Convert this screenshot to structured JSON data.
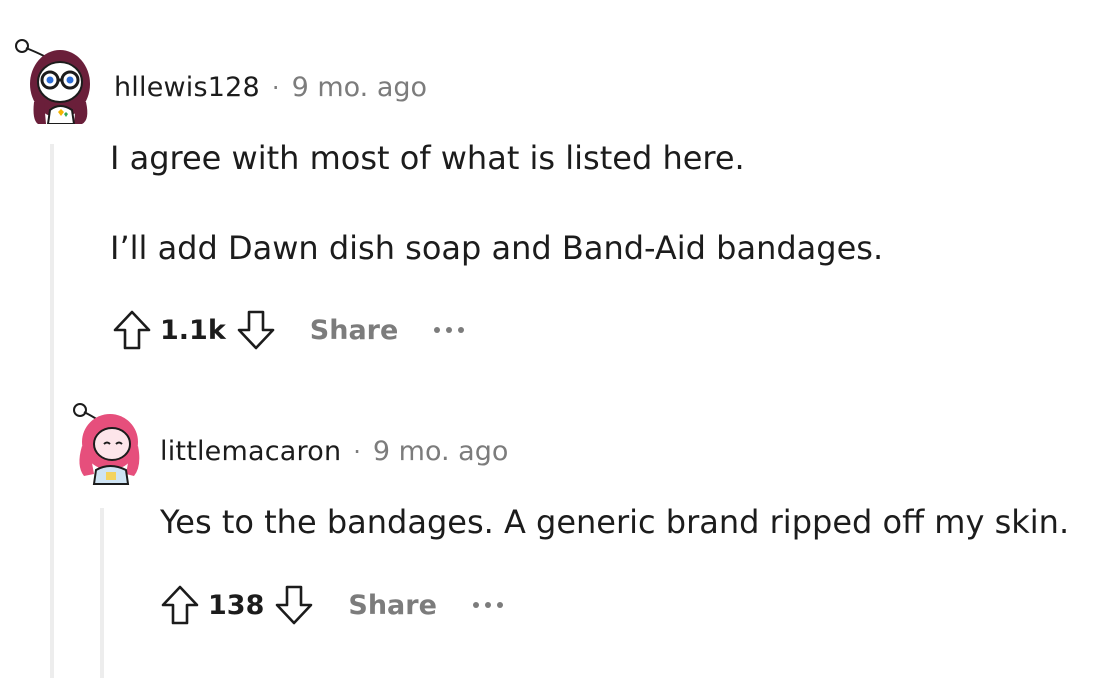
{
  "comments": [
    {
      "username": "hllewis128",
      "separator": "·",
      "time": "9 mo. ago",
      "paragraphs": [
        "I agree with most of what is listed here.",
        "I’ll add Dawn dish soap and Band-Aid bandages."
      ],
      "score": "1.1k",
      "share_label": "Share",
      "avatar_icon": "snoo-avatar-glasses-icon"
    },
    {
      "username": "littlemacaron",
      "separator": "·",
      "time": "9 mo. ago",
      "paragraphs": [
        "Yes to the bandages. A generic brand ripped off my skin."
      ],
      "score": "138",
      "share_label": "Share",
      "avatar_icon": "snoo-avatar-pink-hair-icon"
    }
  ],
  "colors": {
    "text": "#1c1c1c",
    "meta": "#7c7c7c",
    "thread_line": "#ededed"
  }
}
